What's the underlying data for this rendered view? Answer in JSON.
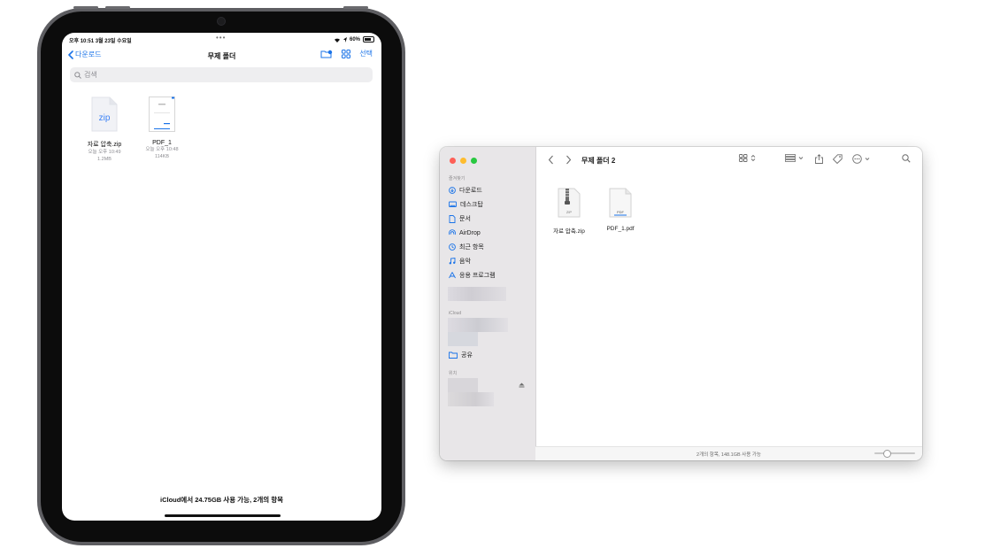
{
  "ipad": {
    "status": {
      "time": "오후 10:51  3월 23일 수요일",
      "dots": "•••",
      "battery": "60%"
    },
    "nav": {
      "back_label": "다운로드",
      "title": "무제 폴더",
      "select_label": "선택"
    },
    "search": {
      "placeholder": "검색"
    },
    "files": [
      {
        "name": "자료 압축.zip",
        "date": "오늘 오후 10:49",
        "size": "1.2MB",
        "thumb": "zip"
      },
      {
        "name": "PDF_1",
        "date": "오늘 오후 10:48",
        "size": "114KB",
        "thumb": "pdf"
      }
    ],
    "footer": "iCloud에서 24.75GB 사용 가능, 2개의 항목",
    "colors": {
      "accent": "#1a73e8"
    }
  },
  "finder": {
    "title": "무제 폴더 2",
    "sidebar": {
      "favorites_header": "즐겨찾기",
      "favorites": [
        {
          "label": "다운로드",
          "icon": "download-icon"
        },
        {
          "label": "데스크탑",
          "icon": "desktop-icon"
        },
        {
          "label": "문서",
          "icon": "document-icon"
        },
        {
          "label": "AirDrop",
          "icon": "airdrop-icon"
        },
        {
          "label": "최근 항목",
          "icon": "clock-icon"
        },
        {
          "label": "음악",
          "icon": "music-icon"
        },
        {
          "label": "응용 프로그램",
          "icon": "apps-icon"
        }
      ],
      "icloud_header": "iCloud",
      "shared_label": "공유",
      "locations_header": "위치"
    },
    "files": [
      {
        "name": "자료 압축.zip",
        "thumb_label": "ZIP"
      },
      {
        "name": "PDF_1.pdf",
        "thumb_label": "PDF"
      }
    ],
    "status": "2개의 항목, 148.1GB 사용 가능",
    "colors": {
      "traffic_red": "#fe5f57",
      "traffic_yellow": "#febc2e",
      "traffic_green": "#28c840",
      "accent": "#1a73e8"
    }
  }
}
